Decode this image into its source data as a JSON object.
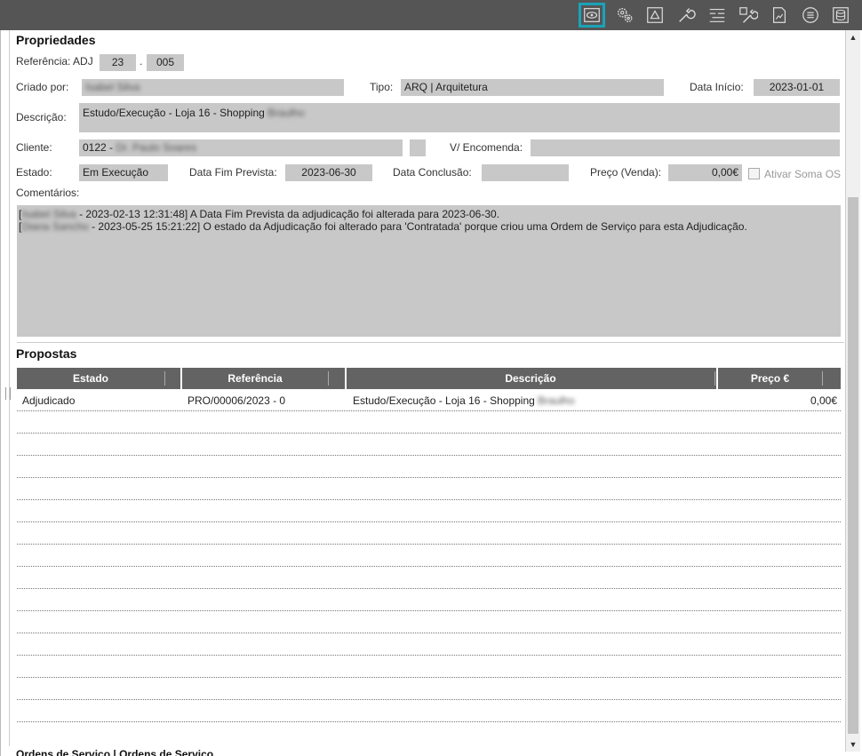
{
  "toolbar": {
    "buttons": [
      {
        "icon": "eye-icon",
        "active": true
      },
      {
        "icon": "gears-icon"
      },
      {
        "icon": "warning-icon"
      },
      {
        "icon": "wrench-icon"
      },
      {
        "icon": "hierarchy-list-icon"
      },
      {
        "icon": "tools-icon"
      },
      {
        "icon": "document-icon"
      },
      {
        "icon": "list-circle-icon"
      },
      {
        "icon": "database-icon"
      }
    ]
  },
  "properties": {
    "title": "Propriedades",
    "referencia_label": "Referência: ADJ",
    "referencia_year": "23",
    "referencia_dot": ".",
    "referencia_num": "005",
    "criado_por_label": "Criado por:",
    "criado_por_value": "Isabel Silva",
    "tipo_label": "Tipo:",
    "tipo_value": "ARQ | Arquitetura",
    "data_inicio_label": "Data Início:",
    "data_inicio_value": "2023-01-01",
    "descricao_label": "Descrição:",
    "descricao_value": "Estudo/Execução - Loja 16 - Shopping",
    "descricao_blur": "Braulho",
    "cliente_label": "Cliente:",
    "cliente_value": "0122 -",
    "cliente_blur": "Dr. Paulo Soares",
    "encomenda_label": "V/ Encomenda:",
    "estado_label": "Estado:",
    "estado_value": "Em Execução",
    "data_fim_label": "Data Fim Prevista:",
    "data_fim_value": "2023-06-30",
    "data_conclusao_label": "Data Conclusão:",
    "preco_label": "Preço (Venda):",
    "preco_value": "0,00€",
    "soma_os_label": "Ativar Soma OS",
    "comentarios_label": "Comentários:",
    "comments": [
      {
        "author": "Isabel Silva",
        "text": "- 2023-02-13 12:31:48] A Data Fim Prevista da adjudicação foi alterada para  2023-06-30."
      },
      {
        "author": "Diana Sancho",
        "text": "- 2023-05-25 15:21:22] O estado da Adjudicação foi alterado para 'Contratada' porque criou uma Ordem de Serviço para esta Adjudicação."
      }
    ]
  },
  "propostas": {
    "title": "Propostas",
    "headers": [
      "Estado",
      "Referência",
      "Descrição",
      "Preço €"
    ],
    "rows": [
      {
        "estado": "Adjudicado",
        "referencia": "PRO/00006/2023 - 0",
        "descricao": "Estudo/Execução - Loja 16 - Shopping",
        "descricao_blur": "Braulho",
        "preco": "0,00€"
      }
    ]
  },
  "footer": {
    "cut_text": "Ordens de Serviço | Ordens de Serviço"
  }
}
